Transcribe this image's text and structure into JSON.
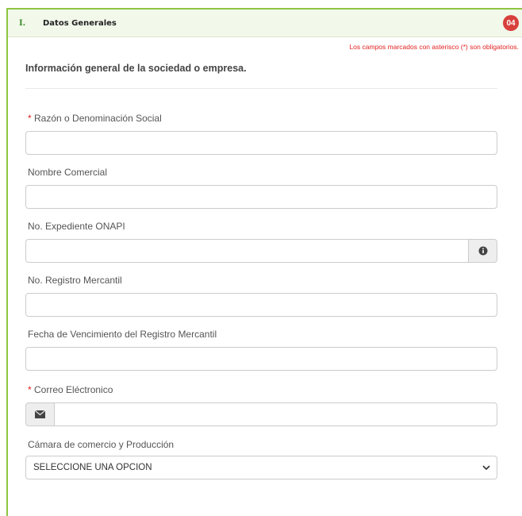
{
  "section": {
    "number": "I.",
    "title": "Datos Generales",
    "step_badge": "04"
  },
  "required_note": "Los campos marcados con asterisco (*) son obligatorios.",
  "info_title": "Información general de la sociedad o empresa.",
  "fields": {
    "razon_social": {
      "label": "Razón o Denominación Social",
      "required": "*",
      "value": ""
    },
    "nombre_comercial": {
      "label": "Nombre Comercial",
      "value": ""
    },
    "expediente_onapi": {
      "label": "No. Expediente ONAPI",
      "value": "",
      "icon": "info-circle-icon"
    },
    "registro_mercantil": {
      "label": "No. Registro Mercantil",
      "value": ""
    },
    "fecha_vencimiento": {
      "label": "Fecha de Vencimiento del Registro Mercantil",
      "value": ""
    },
    "correo": {
      "label": "Correo Eléctronico",
      "required": "*",
      "value": "",
      "icon": "envelope-icon"
    },
    "camara": {
      "label": "Cámara de comercio y Producción",
      "selected": "SELECCIONE UNA OPCION"
    }
  },
  "colors": {
    "accent_green": "#8dc63f",
    "required_red": "#e22020",
    "badge_red": "#d8403c"
  }
}
